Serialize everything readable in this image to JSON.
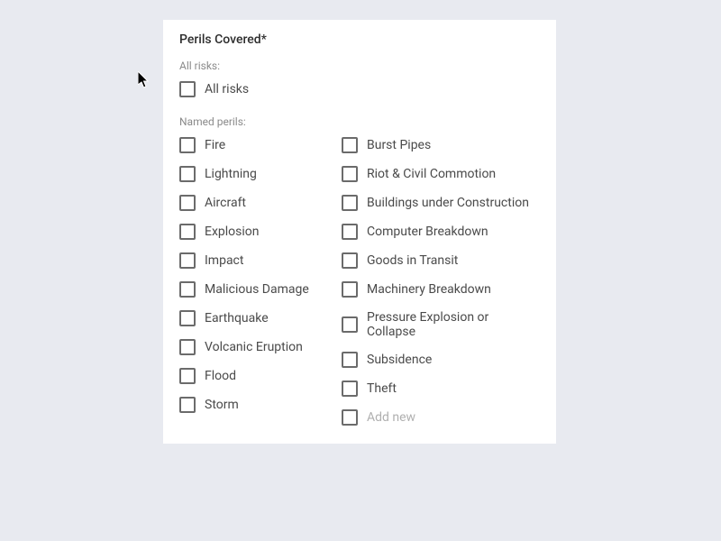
{
  "title": "Perils Covered*",
  "sections": {
    "allRisks": {
      "heading": "All risks:",
      "item": {
        "label": "All risks"
      }
    },
    "namedPerils": {
      "heading": "Named perils:",
      "left": [
        {
          "label": "Fire"
        },
        {
          "label": "Lightning"
        },
        {
          "label": "Aircraft"
        },
        {
          "label": "Explosion"
        },
        {
          "label": "Impact"
        },
        {
          "label": "Malicious Damage"
        },
        {
          "label": "Earthquake"
        },
        {
          "label": "Volcanic Eruption"
        },
        {
          "label": "Flood"
        },
        {
          "label": "Storm"
        }
      ],
      "right": [
        {
          "label": "Burst Pipes"
        },
        {
          "label": "Riot & Civil Commotion"
        },
        {
          "label": "Buildings under Construction"
        },
        {
          "label": "Computer Breakdown"
        },
        {
          "label": "Goods in Transit"
        },
        {
          "label": "Machinery Breakdown"
        },
        {
          "label": "Pressure Explosion or Collapse"
        },
        {
          "label": "Subsidence"
        },
        {
          "label": "Theft"
        }
      ],
      "addNew": {
        "label": "Add new"
      }
    }
  }
}
